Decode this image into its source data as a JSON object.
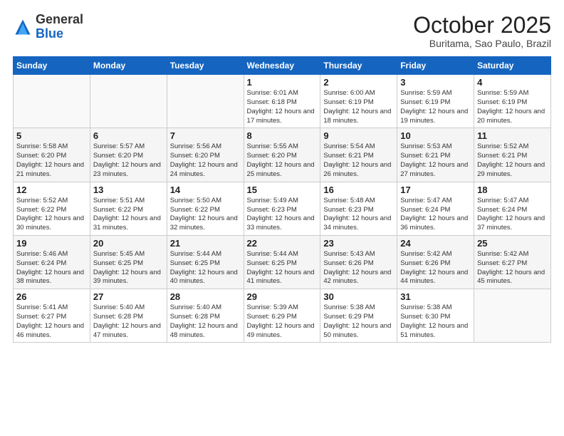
{
  "logo": {
    "general": "General",
    "blue": "Blue"
  },
  "header": {
    "month": "October 2025",
    "location": "Buritama, Sao Paulo, Brazil"
  },
  "weekdays": [
    "Sunday",
    "Monday",
    "Tuesday",
    "Wednesday",
    "Thursday",
    "Friday",
    "Saturday"
  ],
  "weeks": [
    [
      {
        "day": "",
        "info": ""
      },
      {
        "day": "",
        "info": ""
      },
      {
        "day": "",
        "info": ""
      },
      {
        "day": "1",
        "info": "Sunrise: 6:01 AM\nSunset: 6:18 PM\nDaylight: 12 hours and 17 minutes."
      },
      {
        "day": "2",
        "info": "Sunrise: 6:00 AM\nSunset: 6:19 PM\nDaylight: 12 hours and 18 minutes."
      },
      {
        "day": "3",
        "info": "Sunrise: 5:59 AM\nSunset: 6:19 PM\nDaylight: 12 hours and 19 minutes."
      },
      {
        "day": "4",
        "info": "Sunrise: 5:59 AM\nSunset: 6:19 PM\nDaylight: 12 hours and 20 minutes."
      }
    ],
    [
      {
        "day": "5",
        "info": "Sunrise: 5:58 AM\nSunset: 6:20 PM\nDaylight: 12 hours and 21 minutes."
      },
      {
        "day": "6",
        "info": "Sunrise: 5:57 AM\nSunset: 6:20 PM\nDaylight: 12 hours and 23 minutes."
      },
      {
        "day": "7",
        "info": "Sunrise: 5:56 AM\nSunset: 6:20 PM\nDaylight: 12 hours and 24 minutes."
      },
      {
        "day": "8",
        "info": "Sunrise: 5:55 AM\nSunset: 6:20 PM\nDaylight: 12 hours and 25 minutes."
      },
      {
        "day": "9",
        "info": "Sunrise: 5:54 AM\nSunset: 6:21 PM\nDaylight: 12 hours and 26 minutes."
      },
      {
        "day": "10",
        "info": "Sunrise: 5:53 AM\nSunset: 6:21 PM\nDaylight: 12 hours and 27 minutes."
      },
      {
        "day": "11",
        "info": "Sunrise: 5:52 AM\nSunset: 6:21 PM\nDaylight: 12 hours and 29 minutes."
      }
    ],
    [
      {
        "day": "12",
        "info": "Sunrise: 5:52 AM\nSunset: 6:22 PM\nDaylight: 12 hours and 30 minutes."
      },
      {
        "day": "13",
        "info": "Sunrise: 5:51 AM\nSunset: 6:22 PM\nDaylight: 12 hours and 31 minutes."
      },
      {
        "day": "14",
        "info": "Sunrise: 5:50 AM\nSunset: 6:22 PM\nDaylight: 12 hours and 32 minutes."
      },
      {
        "day": "15",
        "info": "Sunrise: 5:49 AM\nSunset: 6:23 PM\nDaylight: 12 hours and 33 minutes."
      },
      {
        "day": "16",
        "info": "Sunrise: 5:48 AM\nSunset: 6:23 PM\nDaylight: 12 hours and 34 minutes."
      },
      {
        "day": "17",
        "info": "Sunrise: 5:47 AM\nSunset: 6:24 PM\nDaylight: 12 hours and 36 minutes."
      },
      {
        "day": "18",
        "info": "Sunrise: 5:47 AM\nSunset: 6:24 PM\nDaylight: 12 hours and 37 minutes."
      }
    ],
    [
      {
        "day": "19",
        "info": "Sunrise: 5:46 AM\nSunset: 6:24 PM\nDaylight: 12 hours and 38 minutes."
      },
      {
        "day": "20",
        "info": "Sunrise: 5:45 AM\nSunset: 6:25 PM\nDaylight: 12 hours and 39 minutes."
      },
      {
        "day": "21",
        "info": "Sunrise: 5:44 AM\nSunset: 6:25 PM\nDaylight: 12 hours and 40 minutes."
      },
      {
        "day": "22",
        "info": "Sunrise: 5:44 AM\nSunset: 6:25 PM\nDaylight: 12 hours and 41 minutes."
      },
      {
        "day": "23",
        "info": "Sunrise: 5:43 AM\nSunset: 6:26 PM\nDaylight: 12 hours and 42 minutes."
      },
      {
        "day": "24",
        "info": "Sunrise: 5:42 AM\nSunset: 6:26 PM\nDaylight: 12 hours and 44 minutes."
      },
      {
        "day": "25",
        "info": "Sunrise: 5:42 AM\nSunset: 6:27 PM\nDaylight: 12 hours and 45 minutes."
      }
    ],
    [
      {
        "day": "26",
        "info": "Sunrise: 5:41 AM\nSunset: 6:27 PM\nDaylight: 12 hours and 46 minutes."
      },
      {
        "day": "27",
        "info": "Sunrise: 5:40 AM\nSunset: 6:28 PM\nDaylight: 12 hours and 47 minutes."
      },
      {
        "day": "28",
        "info": "Sunrise: 5:40 AM\nSunset: 6:28 PM\nDaylight: 12 hours and 48 minutes."
      },
      {
        "day": "29",
        "info": "Sunrise: 5:39 AM\nSunset: 6:29 PM\nDaylight: 12 hours and 49 minutes."
      },
      {
        "day": "30",
        "info": "Sunrise: 5:38 AM\nSunset: 6:29 PM\nDaylight: 12 hours and 50 minutes."
      },
      {
        "day": "31",
        "info": "Sunrise: 5:38 AM\nSunset: 6:30 PM\nDaylight: 12 hours and 51 minutes."
      },
      {
        "day": "",
        "info": ""
      }
    ]
  ]
}
